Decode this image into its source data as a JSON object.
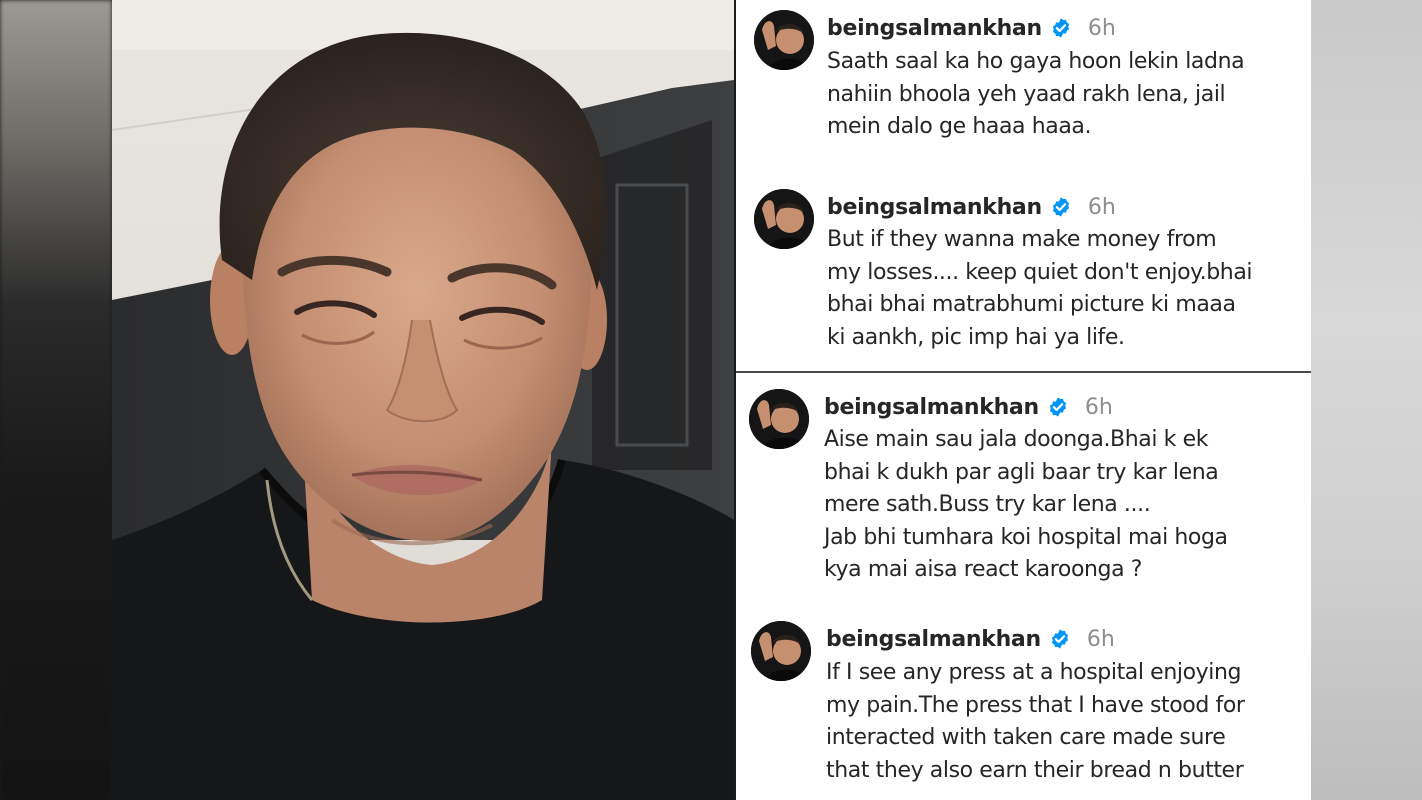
{
  "comments": [
    {
      "username": "beingsalmankhan",
      "time": "6h",
      "lines": [
        "Saath saal ka ho gaya hoon lekin ladna",
        "nahiin bhoola yeh yaad rakh lena, jail",
        "mein dalo ge haaa haaa."
      ]
    },
    {
      "username": "beingsalmankhan",
      "time": "6h",
      "lines": [
        "But  if they wanna make money from",
        "my losses.... keep quiet don't enjoy.bhai",
        "bhai bhai matrabhumi  picture ki maaa",
        "ki aankh, pic imp hai ya life."
      ]
    },
    {
      "username": "beingsalmankhan",
      "time": "6h",
      "lines": [
        "Aise main sau jala doonga.Bhai k ek",
        "bhai k dukh par agli baar try kar lena",
        "mere sath.Buss try kar lena ....",
        "Jab bhi tumhara koi hospital mai hoga",
        "kya mai aisa react karoonga ?"
      ]
    },
    {
      "username": "beingsalmankhan",
      "time": "6h",
      "lines": [
        "If I see any press at a hospital enjoying",
        "my pain.The press that I have stood for",
        "interacted with taken care made sure",
        "that they also earn their bread n butter"
      ]
    }
  ],
  "icons": {
    "verified": "verified-badge-icon",
    "avatar": "profile-avatar"
  },
  "colors": {
    "verified_blue": "#0095f6",
    "username_text": "#262626",
    "timestamp_text": "#8e8e8e"
  }
}
